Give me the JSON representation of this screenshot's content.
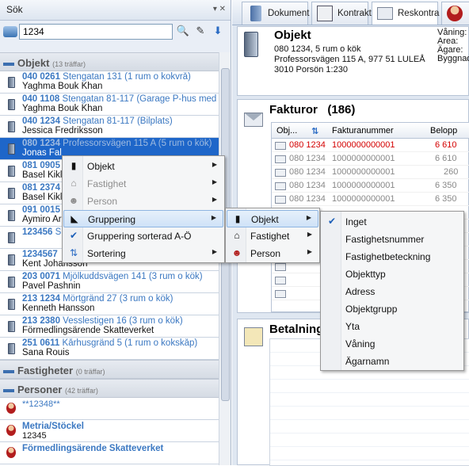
{
  "left": {
    "header": "Sök",
    "header_controls": "▾ ✕",
    "search_value": "1234",
    "groups": {
      "objekt": {
        "name": "Objekt",
        "count": "(13 träffar)"
      },
      "fastigheter": {
        "name": "Fastigheter",
        "count": "(0 träffar)"
      },
      "personer": {
        "name": "Personer",
        "count": "(42 träffar)"
      }
    },
    "items": [
      {
        "l1_bold": "040 0261",
        "l1": " Stengatan 131 (1 rum o kokvrå)",
        "l2": "Yaghma Bouk Khan"
      },
      {
        "l1_bold": "040 1108",
        "l1": " Stengatan 81-117 (Garage P-hus med",
        "l2": "Yaghma Bouk Khan"
      },
      {
        "l1_bold": "040 1234",
        "l1": " Stengatan 81-117 (Bilplats)",
        "l2": "Jessica Fredriksson"
      },
      {
        "l1_bold": "080 1234",
        "l1": " Professorsvägen 115 A (5 rum o kök)",
        "l2": "Jonas Fal"
      },
      {
        "l1_bold": "081 0905",
        "l1": "",
        "l2": "Basel Kikl"
      },
      {
        "l1_bold": "081 2374",
        "l1": "",
        "l2": "Basel Kikl"
      },
      {
        "l1_bold": "091 0015",
        "l1": "",
        "l2": "Aymiro Ar"
      },
      {
        "l1_bold": "123456",
        "l1": " S",
        "l2": ""
      },
      {
        "l1_bold": "1234567",
        "l1": "",
        "l2": "Kent Johansson"
      },
      {
        "l1_bold": "203 0071",
        "l1": " Mjölkuddsvägen 141 (3 rum o kök)",
        "l2": "Pavel Pashnin"
      },
      {
        "l1_bold": "213 1234",
        "l1": " Mörtgränd 27 (3 rum o kök)",
        "l2": "Kenneth Hansson"
      },
      {
        "l1_bold": "213 2380",
        "l1": " Vesslestigen 16 (3 rum o kök)",
        "l2": "Förmedlingsärende Skatteverket"
      },
      {
        "l1_bold": "251 0611",
        "l1": " Kårhusgränd 5 (1 rum o kokskåp)",
        "l2": "Sana Rouis"
      }
    ],
    "persons": [
      {
        "l1": "",
        "l2": "**12348**"
      },
      {
        "l1": "Metria/Stöckel",
        "l2": "12345"
      },
      {
        "l1": "Förmedlingsärende Skatteverket",
        "l2": ""
      }
    ]
  },
  "tabs": [
    "Dokument",
    "Kontrakt",
    "Reskontra",
    ""
  ],
  "objekt": {
    "title": "Objekt",
    "line1": "080 1234, 5 rum o kök",
    "line2": "Professorsvägen 115 A, 977 51 LULEÅ",
    "line3": "3010 Porsön 1:230",
    "meta": [
      "Våning:",
      "Area:",
      "Ägare:",
      "Byggnad"
    ]
  },
  "fakturor": {
    "title": "Fakturor",
    "count": "(186)",
    "headers": [
      "Obj...",
      "Fakturanummer",
      "Belopp"
    ],
    "rows": [
      {
        "obj": "080 1234",
        "nr": "1000000000001",
        "belopp": "6 610",
        "red": true
      },
      {
        "obj": "080 1234",
        "nr": "1000000000001",
        "belopp": "6 610",
        "red": false
      },
      {
        "obj": "080 1234",
        "nr": "1000000000001",
        "belopp": "260",
        "red": false
      },
      {
        "obj": "080 1234",
        "nr": "1000000000001",
        "belopp": "6 350",
        "red": false
      },
      {
        "obj": "080 1234",
        "nr": "1000000000001",
        "belopp": "6 350",
        "red": false
      }
    ]
  },
  "betalningar": {
    "title": "Betalning"
  },
  "menu1": [
    {
      "label": "Objekt",
      "icon": "building-icon",
      "disabled": false,
      "submenu": true
    },
    {
      "label": "Fastighet",
      "icon": "house-icon",
      "disabled": true,
      "submenu": true
    },
    {
      "label": "Person",
      "icon": "person-icon",
      "disabled": true,
      "submenu": true
    },
    {
      "label": "Gruppering",
      "icon": "grouping-icon",
      "disabled": false,
      "submenu": true
    },
    {
      "label": "Gruppering sorterad A-Ö",
      "icon": "check-icon",
      "disabled": false,
      "submenu": false
    },
    {
      "label": "Sortering",
      "icon": "sort-icon",
      "disabled": false,
      "submenu": true
    }
  ],
  "menu2": [
    {
      "label": "Objekt",
      "icon": "building-icon"
    },
    {
      "label": "Fastighet",
      "icon": "house-icon"
    },
    {
      "label": "Person",
      "icon": "person-icon"
    }
  ],
  "menu3": [
    "Inget",
    "Fastighetsnummer",
    "Fastighetbeteckning",
    "Objekttyp",
    "Adress",
    "Objektgrupp",
    "Yta",
    "Våning",
    "Ägarnamn"
  ]
}
